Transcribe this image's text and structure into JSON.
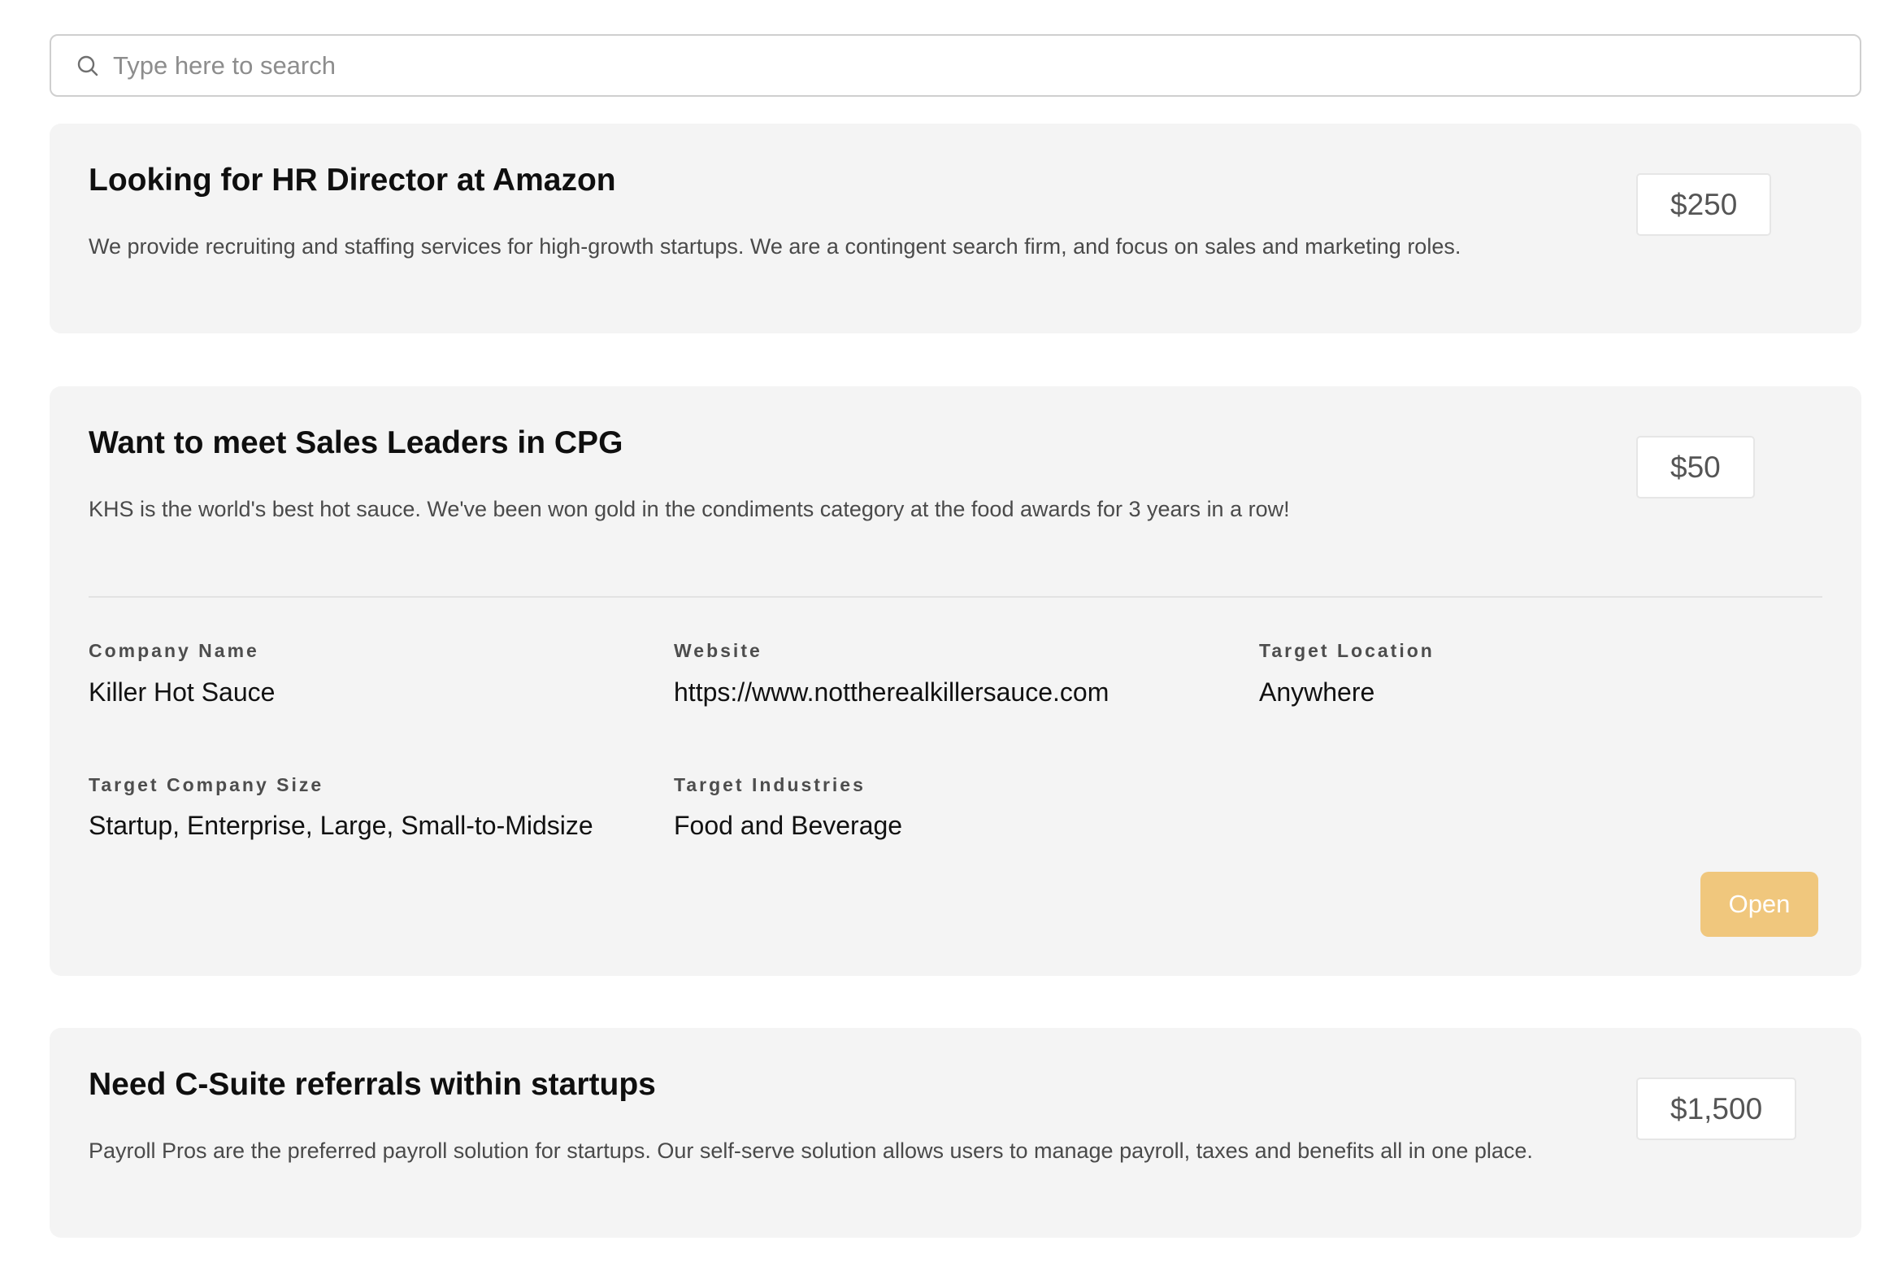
{
  "search": {
    "placeholder": "Type here to search",
    "icon": "search-icon"
  },
  "listings": [
    {
      "title": "Looking for HR Director at Amazon",
      "description": "We provide recruiting and staffing services for high-growth startups. We are a contingent search firm, and focus on sales and marketing roles.",
      "price": "$250"
    },
    {
      "title": "Want to meet Sales Leaders in CPG",
      "description": "KHS is the world's best hot sauce. We've been won gold in the condiments category at the food awards for 3 years in a row!",
      "price": "$50",
      "details": {
        "company_name_label": "Company Name",
        "company_name": "Killer Hot Sauce",
        "website_label": "Website",
        "website": "https://www.nottherealkillersauce.com",
        "target_location_label": "Target Location",
        "target_location": "Anywhere",
        "target_company_size_label": "Target Company Size",
        "target_company_size": "Startup, Enterprise, Large, Small-to-Midsize",
        "target_industries_label": "Target Industries",
        "target_industries": "Food and Beverage"
      },
      "status_button": "Open"
    },
    {
      "title": "Need C-Suite referrals within startups",
      "description": "Payroll Pros are the preferred payroll solution for startups. Our self-serve solution allows users to manage payroll, taxes and benefits all in one place.",
      "price": "$1,500"
    }
  ],
  "colors": {
    "card_background": "#f4f4f4",
    "open_button": "#f0c77d",
    "price_text": "#555555"
  }
}
